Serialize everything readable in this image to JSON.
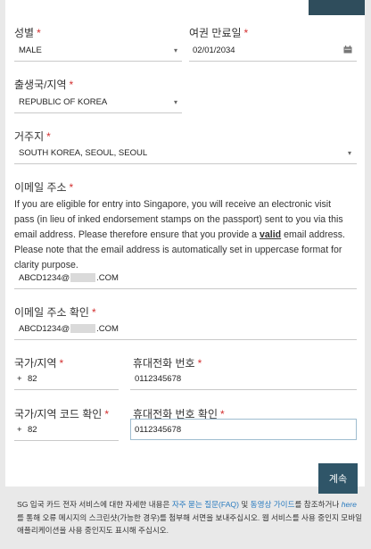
{
  "form": {
    "gender": {
      "label": "성별",
      "value": "MALE"
    },
    "passport_expiry": {
      "label": "여권 만료일",
      "value": "02/01/2034"
    },
    "birth_country": {
      "label": "출생국/지역",
      "value": "REPUBLIC OF KOREA"
    },
    "residence": {
      "label": "거주지",
      "value": "SOUTH KOREA, SEOUL, SEOUL"
    },
    "email": {
      "label": "이메일 주소",
      "info_before": "If you are eligible for entry into Singapore, you will receive an electronic visit pass (in lieu of inked endorsement stamps on the passport) sent to you via this email address. Please therefore ensure that you provide a ",
      "info_bold": "valid",
      "info_after": " email address. Please note that the email address is automatically set in uppercase format for clarity purpose.",
      "value_prefix": "ABCD1234@",
      "value_suffix": ".COM"
    },
    "email_confirm": {
      "label": "이메일 주소 확인",
      "value_prefix": "ABCD1234@",
      "value_suffix": ".COM"
    },
    "country_code": {
      "label": "국가/지역",
      "plus": "+",
      "value": "82"
    },
    "phone": {
      "label": "휴대전화 번호",
      "value": "0112345678"
    },
    "country_code_confirm": {
      "label": "국가/지역 코드 확인",
      "plus": "+",
      "value": "82"
    },
    "phone_confirm": {
      "label": "휴대전화 번호 확인",
      "value": "0112345678"
    },
    "required_mark": "*"
  },
  "continue_label": "계속",
  "footer": {
    "text1": "SG 입국 카드 전자 서비스에 대한 자세한 내용은 ",
    "faq_link": "자주 묻는 질문(FAQ)",
    "text2": " 및 ",
    "guide_link": "동영상 가이드",
    "text3": "를 참조하거나 ",
    "here_link": "here",
    "text4": "를 통해 오류 메시지의 스크린샷(가능한 경우)를 첨부해 서면을 보내주십시오. 웹 서비스를 사용 중인지 모바일 애플리케이션을 사용 중인지도 표시해 주십시오."
  },
  "colors": {
    "accent": "#2f5568",
    "required": "#d32f2f",
    "link": "#2a7bbf"
  },
  "icons": {
    "date": "calendar-icon",
    "dropdown": "chevron-down-icon"
  }
}
